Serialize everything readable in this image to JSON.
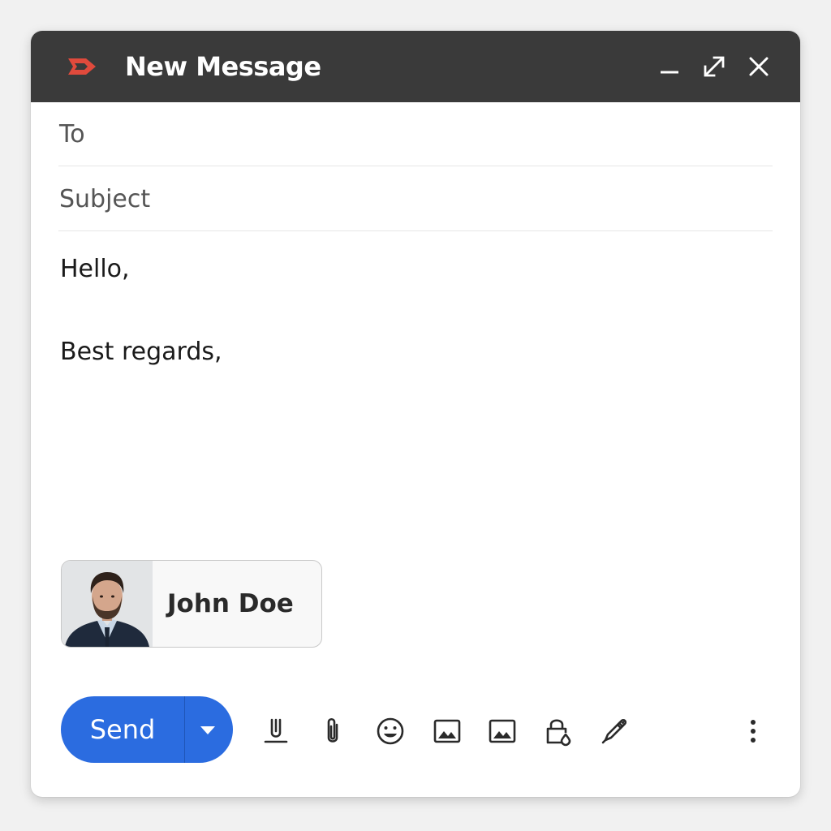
{
  "window": {
    "title": "New Message",
    "title_bar_color": "#3a3a3a",
    "app_icon": "red-arrow-logo",
    "controls": [
      "minimize-icon",
      "expand-icon",
      "close-icon"
    ]
  },
  "compose": {
    "to": {
      "label": "To",
      "value": ""
    },
    "subject": {
      "label": "Subject",
      "value": ""
    },
    "body": [
      "Hello,",
      "Best regards,"
    ]
  },
  "contact_chip": {
    "name": "John Doe",
    "avatar": "portrait-photo"
  },
  "toolbar": {
    "send_label": "Send",
    "send_color": "#2b6ce0",
    "tools": [
      "text-formatting-icon",
      "attachment-icon",
      "emoji-icon",
      "insert-photo-icon",
      "insert-image-icon",
      "confidential-mode-icon",
      "signature-pen-icon",
      "more-options-icon"
    ]
  }
}
